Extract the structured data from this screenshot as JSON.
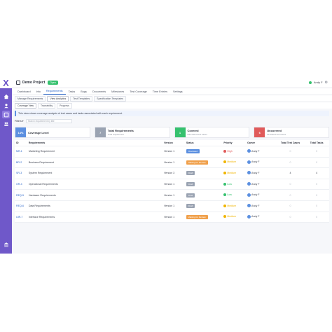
{
  "app": {
    "logo": "X"
  },
  "colors": {
    "sidebar": "#6f58c9",
    "accent": "#2563c9",
    "open": "#35c16e"
  },
  "header": {
    "project_name": "Demo Project",
    "project_status": "Open",
    "user_name": "Andy F"
  },
  "tabs": [
    {
      "label": "Dashboard"
    },
    {
      "label": "Info"
    },
    {
      "label": "Requirements"
    },
    {
      "label": "Tasks"
    },
    {
      "label": "Bugs"
    },
    {
      "label": "Documents"
    },
    {
      "label": "Milestones"
    },
    {
      "label": "Test Coverage"
    },
    {
      "label": "Time Entries"
    },
    {
      "label": "Settings"
    }
  ],
  "subtabs": [
    {
      "label": "Manage Requirements"
    },
    {
      "label": "View Analytics"
    },
    {
      "label": "Test Templates"
    },
    {
      "label": "Specification Templates"
    }
  ],
  "subtabs2": [
    {
      "label": "Coverage View"
    },
    {
      "label": "Traceability"
    },
    {
      "label": "Progress"
    }
  ],
  "info_text": "This view shows coverage analysis of test cases and tasks associated with each requirement.",
  "filter": {
    "label": "Filters",
    "placeholder": "Search requirement by title"
  },
  "cards": [
    {
      "value": "14%",
      "title": "Coverage Level",
      "sub": "",
      "color": "#5b8fe0"
    },
    {
      "value": "7",
      "title": "Total Requirements",
      "sub": "Total requirement",
      "color": "#9aa3b2"
    },
    {
      "value": "1",
      "title": "Covered",
      "sub": "Has linked test cases",
      "color": "#35c16e"
    },
    {
      "value": "6",
      "title": "Uncovered",
      "sub": "No linked test cases",
      "color": "#e05a5a"
    }
  ],
  "table": {
    "headers": {
      "id": "ID",
      "requirement": "Requirements",
      "version": "Version",
      "status": "Status",
      "priority": "Priority",
      "owner": "Owner",
      "test_cases": "Total Test Cases",
      "tasks": "Total Tasks"
    },
    "rows": [
      {
        "id": "MR-1",
        "requirement": "Marketing Requirement",
        "version": "Version 1",
        "status": "Reviewed",
        "status_color": "#5b8fe0",
        "priority": "High",
        "priority_color": "#e05a5a",
        "owner": "Andy F",
        "test_cases": "0",
        "tasks": "0"
      },
      {
        "id": "BR-2",
        "requirement": "Business Requirement",
        "version": "Version 1",
        "status": "Waiting for Review",
        "status_color": "#f0a04b",
        "priority": "Medium",
        "priority_color": "#f0b400",
        "owner": "Andy F",
        "test_cases": "0",
        "tasks": "0"
      },
      {
        "id": "SR-3",
        "requirement": "System Requirement",
        "version": "Version 3",
        "status": "Draft",
        "status_color": "#9aa3b2",
        "priority": "Medium",
        "priority_color": "#f0b400",
        "owner": "Andy F",
        "test_cases": "4",
        "tasks": "4"
      },
      {
        "id": "OR-4",
        "requirement": "Operational Requirements",
        "version": "Version 1",
        "status": "Draft",
        "status_color": "#9aa3b2",
        "priority": "Low",
        "priority_color": "#35c16e",
        "owner": "Andy F",
        "test_cases": "0",
        "tasks": "0"
      },
      {
        "id": "REQ-5",
        "requirement": "Hardware Requirements",
        "version": "Version 1",
        "status": "Draft",
        "status_color": "#9aa3b2",
        "priority": "Low",
        "priority_color": "#35c16e",
        "owner": "Andy F",
        "test_cases": "0",
        "tasks": "0"
      },
      {
        "id": "REQ-6",
        "requirement": "Data Requirements",
        "version": "Version 1",
        "status": "Draft",
        "status_color": "#9aa3b2",
        "priority": "Medium",
        "priority_color": "#f0b400",
        "owner": "Andy F",
        "test_cases": "0",
        "tasks": "0"
      },
      {
        "id": "UIR-7",
        "requirement": "Interface Requirements",
        "version": "Version 1",
        "status": "Waiting for Review",
        "status_color": "#f0a04b",
        "priority": "Medium",
        "priority_color": "#f0b400",
        "owner": "Andy F",
        "test_cases": "0",
        "tasks": "0"
      }
    ]
  }
}
